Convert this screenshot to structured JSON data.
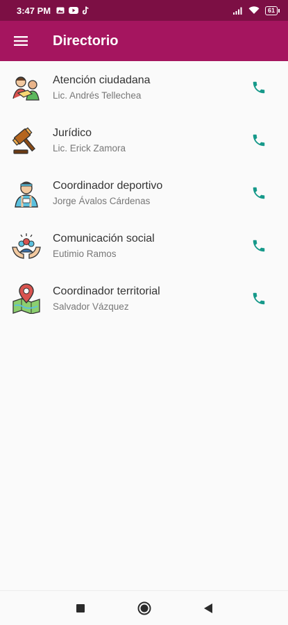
{
  "status": {
    "time": "3:47 PM",
    "battery": "61"
  },
  "app_bar": {
    "title": "Directorio",
    "menu_icon": "menu-icon",
    "color": "#a5155f",
    "status_color": "#7c0f44"
  },
  "contacts": [
    {
      "title": "Atención ciudadana",
      "subtitle": "Lic. Andrés Tellechea",
      "icon": "citizen-service-icon"
    },
    {
      "title": "Jurídico",
      "subtitle": "Lic. Erick Zamora",
      "icon": "gavel-icon"
    },
    {
      "title": "Coordinador deportivo",
      "subtitle": "Jorge Ávalos Cárdenas",
      "icon": "athlete-icon"
    },
    {
      "title": "Comunicación social",
      "subtitle": "Eutimio Ramos",
      "icon": "community-hands-icon"
    },
    {
      "title": "Coordinador territorial",
      "subtitle": "Salvador Vázquez",
      "icon": "map-pin-icon"
    }
  ],
  "call_icon": "phone-icon",
  "accent": "#16998a",
  "nav": [
    "recents-icon",
    "home-icon",
    "back-icon"
  ]
}
